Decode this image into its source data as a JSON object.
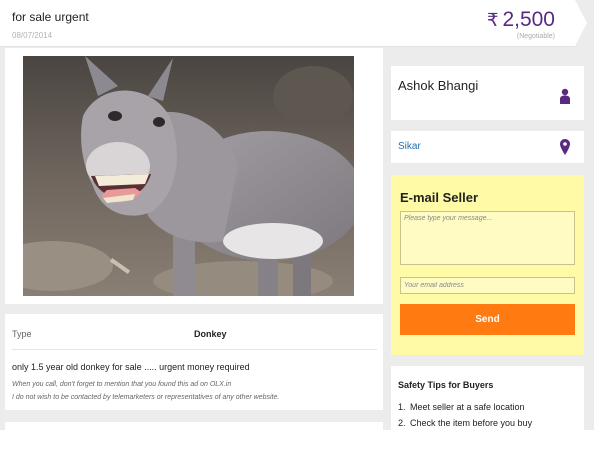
{
  "header": {
    "title": "for sale urgent",
    "date": "08/07/2014",
    "currency_symbol": "₹",
    "price": "2,500",
    "negotiable": "(Negotiable)"
  },
  "photo": {
    "subject": "donkey photo",
    "icon": "donkey-image"
  },
  "details": {
    "type_label": "Type",
    "type_value": "Donkey",
    "description": "only 1.5 year old donkey for sale ..... urgent money required",
    "note_1": "When you call, don't forget to mention that you found this ad on OLX.in",
    "note_2": "I do not wish to be contacted by telemarketers or representatives of any other website."
  },
  "seller": {
    "name": "Ashok Bhangi",
    "icon": "person-icon",
    "location": "Sikar",
    "location_icon": "location-pin-icon"
  },
  "email_seller": {
    "title": "E-mail Seller",
    "message_placeholder": "Please type your message...",
    "email_placeholder": "Your email address",
    "send_label": "Send"
  },
  "safety": {
    "title": "Safety Tips for Buyers",
    "tips": [
      {
        "num": "1.",
        "text": "Meet seller at a safe location"
      },
      {
        "num": "2.",
        "text": "Check the item before you buy"
      }
    ]
  },
  "colors": {
    "accent_purple": "#5a2a82",
    "send_orange": "#ff7a10",
    "email_panel_yellow": "#fffaa6",
    "link_blue": "#2a6fb0"
  }
}
